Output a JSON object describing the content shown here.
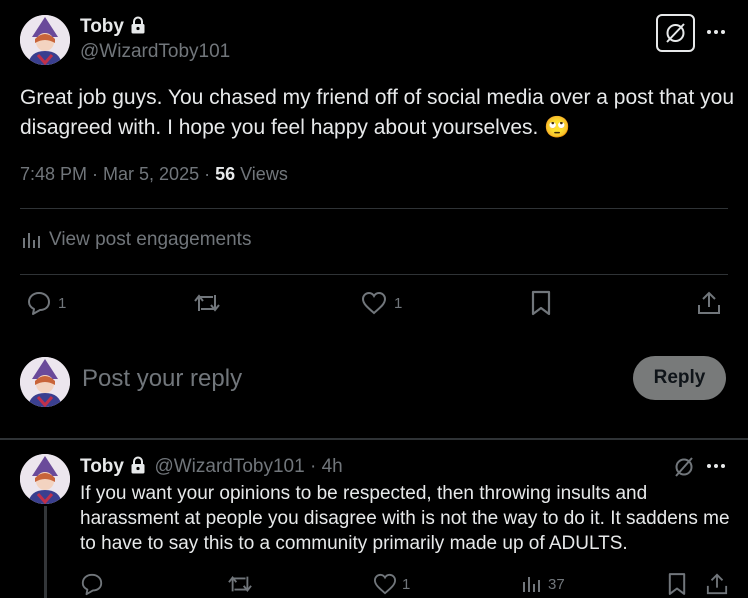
{
  "post": {
    "author_name": "Toby",
    "author_handle": "@WizardToby101",
    "text": "Great job guys. You chased my friend off of social media over a post that you disagreed with. I hope you feel happy about yourselves.",
    "emoji": "🙄",
    "time": "7:48 PM · Mar 5, 2025 · ",
    "views_count": "56",
    "views_label": " Views",
    "engagements_label": "View post engagements",
    "reply_count": "1",
    "like_count": "1"
  },
  "composer": {
    "placeholder": "Post your reply",
    "reply_button": "Reply"
  },
  "reply": {
    "author_name": "Toby",
    "author_handle": "@WizardToby101",
    "time_ago": " · 4h",
    "text": "If you want your opinions to be respected, then throwing insults and harassment at people you disagree with is not the way to do it. It saddens me to have to say this to a community primarily made up of ADULTS.",
    "like_count": "1",
    "view_count": "37"
  },
  "icons": {
    "grok": "grok-icon",
    "more": "more-icon",
    "lock": "lock-icon",
    "reply": "reply-icon",
    "repost": "repost-icon",
    "like": "like-icon",
    "bookmark": "bookmark-icon",
    "share": "share-icon",
    "analytics": "analytics-icon"
  },
  "colors": {
    "background": "#000000",
    "text": "#e7e9ea",
    "muted": "#71767b",
    "divider": "#2f3336",
    "reply_button": "#787a7a"
  }
}
